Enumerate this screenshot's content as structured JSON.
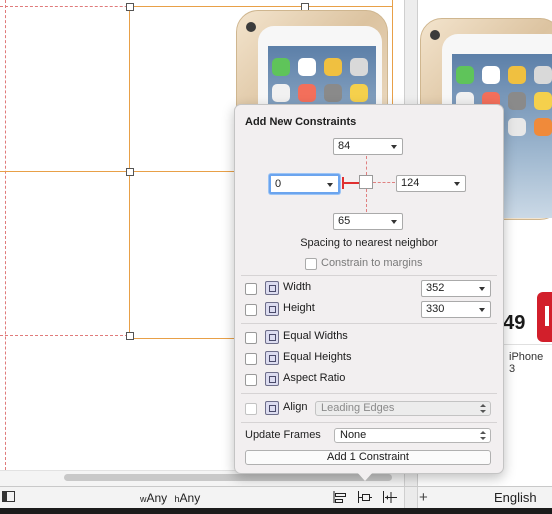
{
  "popover": {
    "title": "Add New Constraints",
    "top_value": "84",
    "left_value": "0",
    "right_value": "124",
    "bottom_value": "65",
    "spacing_caption": "Spacing to nearest neighbor",
    "constrain_to_margins_label": "Constrain to margins",
    "width_label": "Width",
    "width_value": "352",
    "height_label": "Height",
    "height_value": "330",
    "equal_widths_label": "Equal Widths",
    "equal_heights_label": "Equal Heights",
    "aspect_ratio_label": "Aspect Ratio",
    "align_label": "Align",
    "align_value": "Leading Edges",
    "update_frames_label": "Update Frames",
    "update_frames_value": "None",
    "add_button_label": "Add 1 Constraint"
  },
  "right_panel": {
    "price": "649",
    "phone_name": "iPhone 3"
  },
  "bottom_bar": {
    "w_prefix": "w",
    "w_value": "Any",
    "h_prefix": "h",
    "h_value": "Any",
    "add_symbol": "+",
    "language": "English"
  },
  "colors": {
    "constraint_red": "#e03030",
    "frame_orange": "#e8a048",
    "buy_red": "#d21f2b"
  }
}
